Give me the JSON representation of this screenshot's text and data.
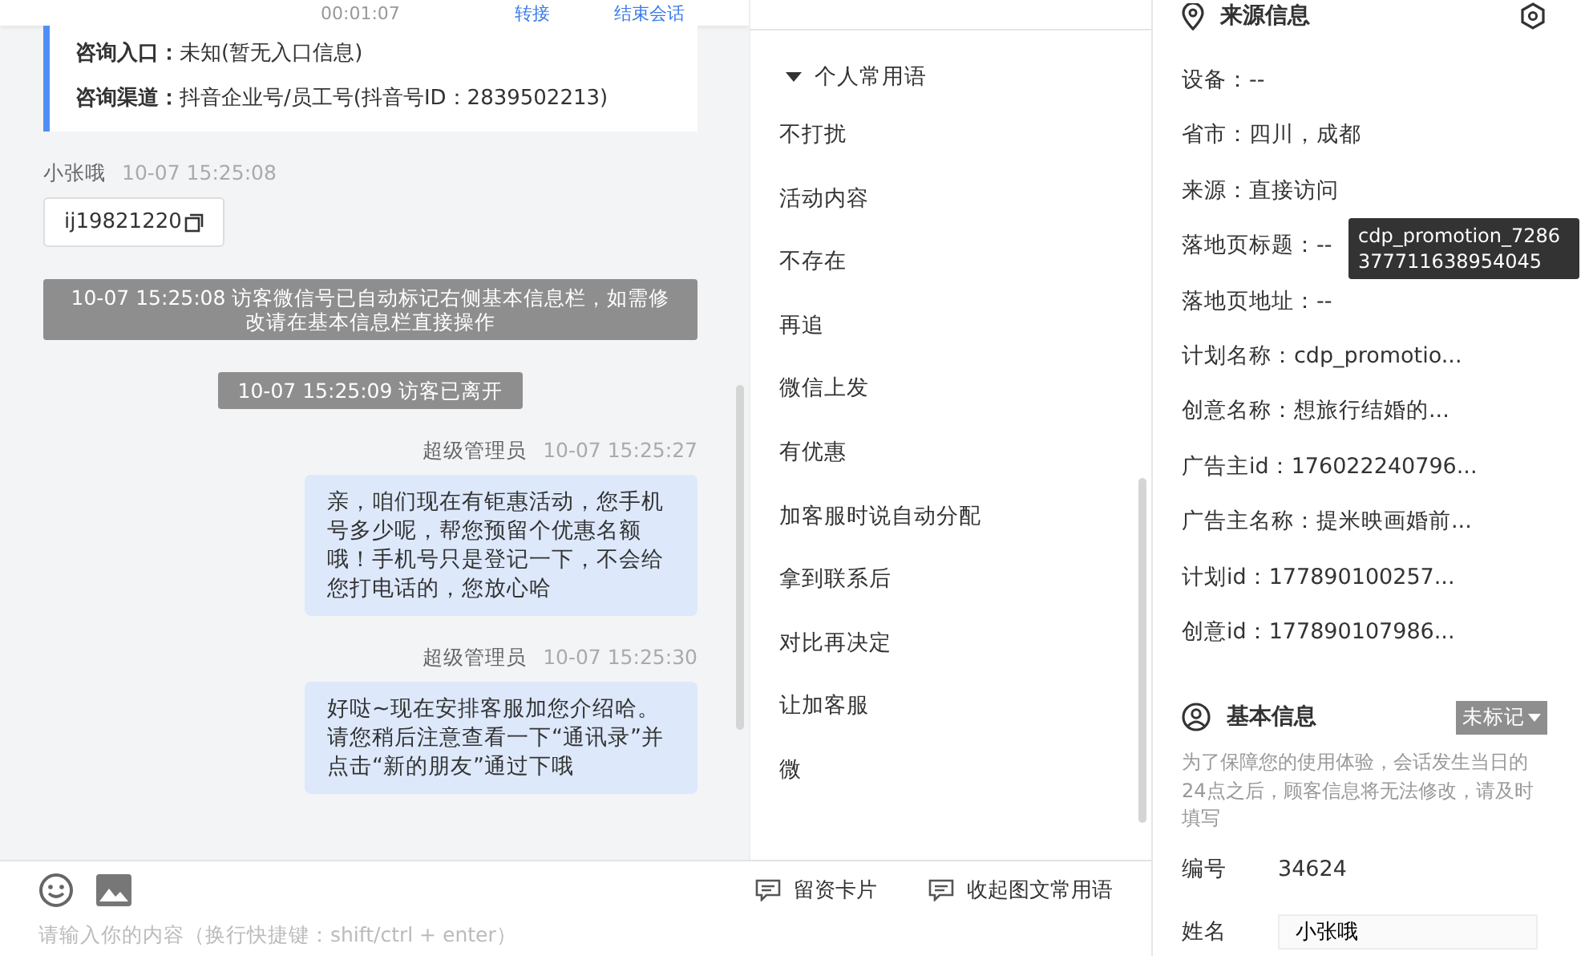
{
  "chat_header": {
    "timer": "00:01:07",
    "actions": [
      "转接",
      "结束会话"
    ]
  },
  "consult_info": [
    {
      "label": "咨询入口：",
      "value": "未知(暂无入口信息)"
    },
    {
      "label": "咨询渠道：",
      "value": "抖音企业号/员工号(抖音号ID：2839502213)"
    }
  ],
  "messages": [
    {
      "kind": "visitor",
      "sender": "小张哦",
      "time": "10-07 15:25:08",
      "text": "ij19821220"
    },
    {
      "kind": "system",
      "text": "10-07 15:25:08 访客微信号已自动标记右侧基本信息栏，如需修改请在基本信息栏直接操作"
    },
    {
      "kind": "system",
      "text": "10-07 15:25:09 访客已离开"
    },
    {
      "kind": "agent",
      "sender": "超级管理员",
      "time": "10-07 15:25:27",
      "text": "亲，咱们现在有钜惠活动，您手机号多少呢，帮您预留个优惠名额哦！手机号只是登记一下，不会给您打电话的，您放心哈"
    },
    {
      "kind": "agent",
      "sender": "超级管理员",
      "time": "10-07 15:25:30",
      "text": "好哒~现在安排客服加您介绍哈。请您稍后注意查看一下“通讯录”并点击“新的朋友”通过下哦"
    }
  ],
  "phrases": {
    "group": "个人常用语",
    "expanded": true,
    "items": [
      "不打扰",
      "活动内容",
      "不存在",
      "再追",
      "微信上发",
      "有优惠",
      "加客服时说自动分配",
      "拿到联系后",
      "对比再决定",
      "让加客服",
      "微"
    ]
  },
  "composer": {
    "placeholder": "请输入你的内容（换行快捷键：shift/ctrl + enter）",
    "actions": [
      "留资卡片",
      "收起图文常用语"
    ]
  },
  "source_info": {
    "title": "来源信息",
    "rows": [
      "设备：--",
      "省市：四川，成都",
      "来源：直接访问",
      "落地页标题：--",
      "落地页地址：--",
      "计划名称：cdp_promotio...",
      "创意名称：想旅行结婚的...",
      "广告主id：176022240796...",
      "广告主名称：提米映画婚前...",
      "计划id：177890100257...",
      "创意id：177890107986..."
    ],
    "tooltip": "cdp_promotion_7286377711638954045"
  },
  "basic_info": {
    "title": "基本信息",
    "tag": "未标记",
    "note": "为了保障您的使用体验，会话发生当日的24点之后，顾客信息将无法修改，请及时填写",
    "fields": [
      {
        "kind": "text",
        "label": "编号",
        "value": "34624"
      },
      {
        "kind": "input",
        "label": "姓名",
        "value": "小张哦"
      }
    ]
  }
}
